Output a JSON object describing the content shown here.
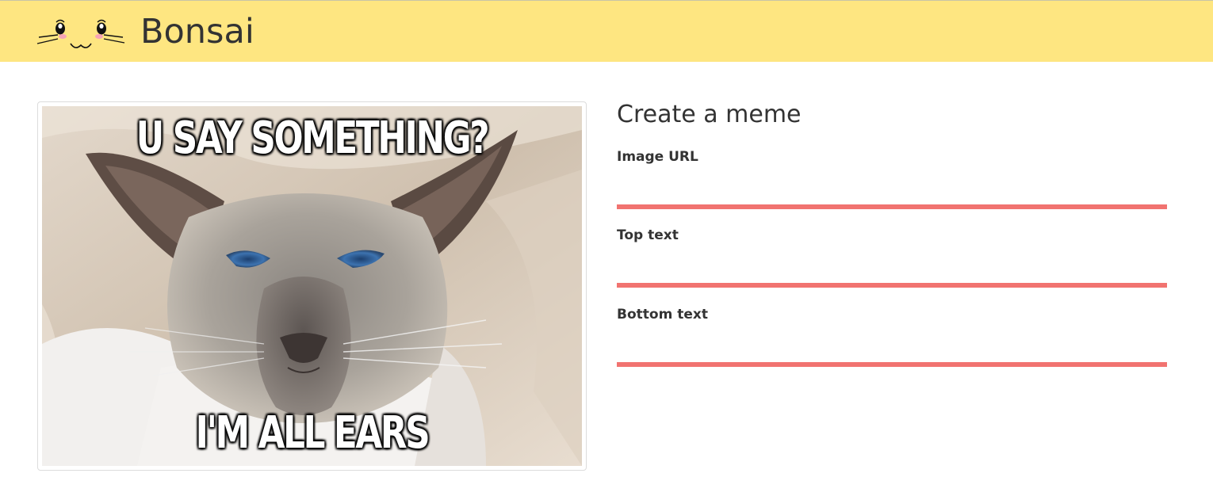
{
  "header": {
    "brand": "Bonsai",
    "logo_icon": "cat-face-icon",
    "background": "#fee681"
  },
  "preview": {
    "image_alt": "Siamese cat meme",
    "top_text": "U SAY SOMETHING?",
    "bottom_text": "I'M ALL EARS"
  },
  "form": {
    "title": "Create a meme",
    "accent": "#f17370",
    "fields": [
      {
        "label": "Image URL",
        "value": "",
        "placeholder": ""
      },
      {
        "label": "Top text",
        "value": "",
        "placeholder": ""
      },
      {
        "label": "Bottom text",
        "value": "",
        "placeholder": ""
      }
    ]
  }
}
